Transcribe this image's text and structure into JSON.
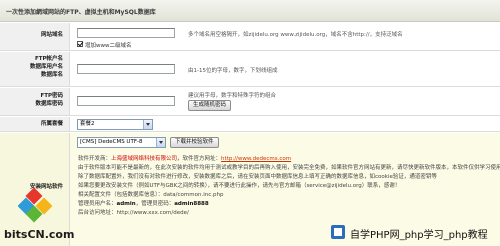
{
  "header": {
    "title": "一次性添加網域网站的FTP、虚拟主机和MySQL数据库"
  },
  "domain_row": {
    "label": "网站域名",
    "input_value": "",
    "hint": "多个域名用空格隔开，如zijidelu.org www.zijidelu.org，域名不含http://，支持泛域名",
    "checkbox_label": "增加www二级域名",
    "checkbox_checked": true
  },
  "ftp_user_row": {
    "label_lines": [
      "FTP帐户名",
      "数据库用户名",
      "数据库名"
    ],
    "input_value": "",
    "hint": "由1-15位的字母，数字，下划线组成"
  },
  "ftp_pass_row": {
    "label_lines": [
      "FTP密码",
      "数据库密码"
    ],
    "input_value": "",
    "hint": "建议用字母，数字和特殊字符的组合",
    "generate_button": "生成随机密码"
  },
  "package_row": {
    "label": "所属套餐",
    "selected": "套餐2"
  },
  "install_row": {
    "label": "安装网站软件",
    "software_selected": "[CMS] DedeCMS UTF-8",
    "download_button": "下载并校验软件",
    "lines": [
      {
        "pre": "软件开发商：",
        "red": "上海盛域网络科技有限公司",
        "mid": "，软件官方网址：",
        "link": "http://www.dedecms.com"
      },
      {
        "text": "由于软件版本可能不是最新的，在此次安装的软件均用于测试或教学目的后再购入使用，安装完全免费，如果软件官方网站有更新，请尽快更新软件版本，本软件仅供学习使用"
      },
      {
        "text": "除了数据库配置外，我们没有对软件进行修改，安装数据库之后，请在安装页面中数据库信息上填写正确的数据库信息，如cookie验证，通道密钥等"
      },
      {
        "text": "如果您要更改安装文件（例如UTF与GBK之间的转换），请不要进行此操作，请先与官方邮箱（service@zijidelu.org）联系，感谢！"
      },
      {
        "pre": "相关配置文件（包括数据库信息）：",
        "plain": "data/common.inc.php"
      },
      {
        "pre": "管理员用户名：",
        "bold": "admin",
        "mid": "，管理员密码：",
        "bold2": "admin8888"
      },
      {
        "pre": "后台访问地址：",
        "plain": "http://www.xxx.com/dede/"
      }
    ]
  },
  "watermark": {
    "text": "自学PHP网_php学习_php教程"
  },
  "logo": {
    "text": "bitsCN.com"
  },
  "colors": {
    "accent_link": "#cc3300",
    "vendor_red": "#d00000",
    "install_bg": "#fbfbe6"
  }
}
